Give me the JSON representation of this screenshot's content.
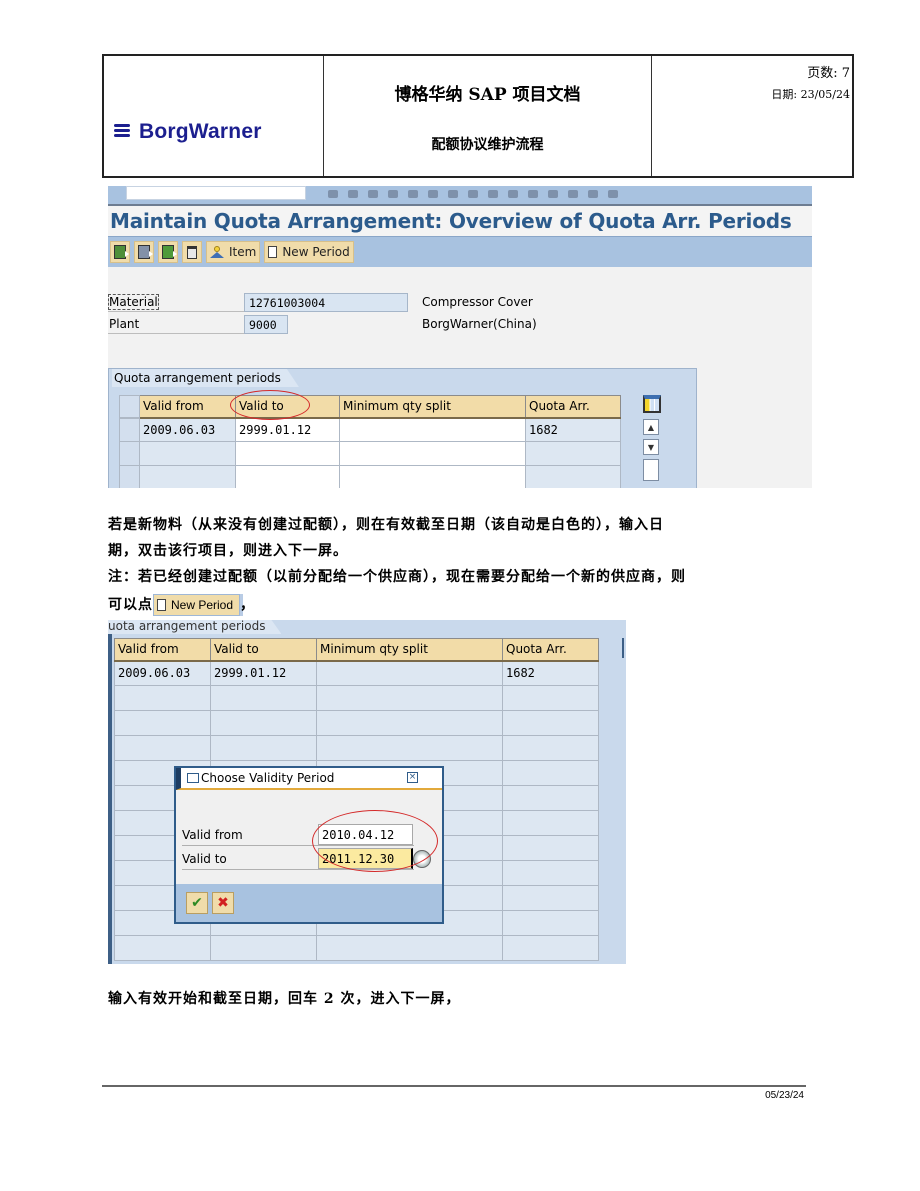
{
  "header": {
    "logo_text": "BorgWarner",
    "title": "博格华纳 SAP 项目文档",
    "subtitle": "配额协议维护流程",
    "page_label": "页数: 7",
    "date_label": "日期: 23/05/24"
  },
  "sap_screen_1": {
    "title": "Maintain Quota Arrangement: Overview of Quota Arr. Periods",
    "toolbar": {
      "icons": [
        "select-all-icon",
        "deselect-icon",
        "select-block-icon",
        "delete-icon"
      ],
      "item_label": "Item",
      "new_period_label": "New Period"
    },
    "fields": {
      "material_label": "Material",
      "material_value": "12761003004",
      "material_desc": "Compressor Cover",
      "plant_label": "Plant",
      "plant_value": "9000",
      "plant_desc": "BorgWarner(China)"
    },
    "table": {
      "tab_label": "Quota arrangement periods",
      "columns": [
        "Valid from",
        "Valid to",
        "Minimum qty split",
        "Quota Arr."
      ],
      "rows": [
        [
          "2009.06.03",
          "2999.01.12",
          "",
          "1682"
        ],
        [
          "",
          "",
          "",
          ""
        ],
        [
          "",
          "",
          "",
          ""
        ]
      ]
    },
    "annotation_color": "#d42a2a"
  },
  "paragraphs": {
    "p1_line1": "若是新物料（从来没有创建过配额），则在有效截至日期（该自动是白色的），输入日",
    "p1_line2": "期，双击该行项目，则进入下一屏。",
    "p2_line1": "注：若已经创建过配额（以前分配给一个供应商），现在需要分配给一个新的供应商，则",
    "p2_prefix": "可以点",
    "p2_button": "New Period",
    "p2_suffix": "，",
    "p3": "输入有效开始和截至日期，回车 2 次，进入下一屏，"
  },
  "sap_screen_2": {
    "tab_label": "uota arrangement periods",
    "columns": [
      "Valid from",
      "Valid to",
      "Minimum qty split",
      "Quota Arr."
    ],
    "rows": [
      [
        "2009.06.03",
        "2999.01.12",
        "",
        "1682"
      ],
      [
        "",
        "",
        "",
        ""
      ],
      [
        "",
        "",
        "",
        ""
      ],
      [
        "",
        "",
        "",
        ""
      ],
      [
        "",
        "",
        "",
        ""
      ],
      [
        "",
        "",
        "",
        ""
      ],
      [
        "",
        "",
        "",
        ""
      ],
      [
        "",
        "",
        "",
        ""
      ],
      [
        "",
        "",
        "",
        ""
      ],
      [
        "",
        "",
        "",
        ""
      ],
      [
        "",
        "",
        "",
        ""
      ],
      [
        "",
        "",
        "",
        ""
      ]
    ],
    "popup": {
      "title": "Choose Validity Period",
      "valid_from_label": "Valid from",
      "valid_from_value": "2010.04.12",
      "valid_to_label": "Valid to",
      "valid_to_value": "2011.12.30",
      "ok_label": "✔",
      "cancel_label": "✖"
    }
  },
  "footer": {
    "date": "05/23/24"
  }
}
